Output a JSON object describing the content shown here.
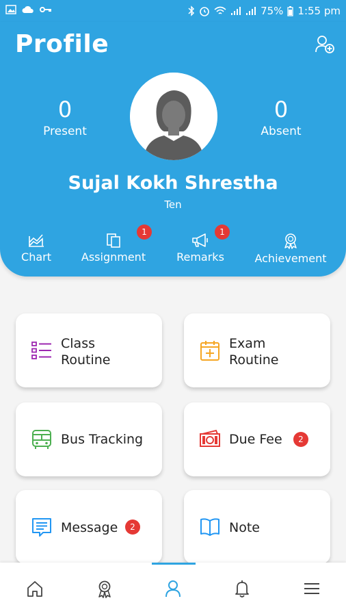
{
  "status_bar": {
    "battery": "75%",
    "time": "1:55 pm"
  },
  "header": {
    "title": "Profile",
    "present_count": "0",
    "present_label": "Present",
    "absent_count": "0",
    "absent_label": "Absent",
    "student_name": "Sujal Kokh Shrestha",
    "student_class": "Ten"
  },
  "quick_actions": [
    {
      "label": "Chart",
      "icon": "chart-icon"
    },
    {
      "label": "Assignment",
      "icon": "assignment-icon",
      "badge": "1"
    },
    {
      "label": "Remarks",
      "icon": "megaphone-icon",
      "badge": "1"
    },
    {
      "label": "Achievement",
      "icon": "award-icon"
    }
  ],
  "menu": {
    "class_routine": {
      "line1": "Class",
      "line2": "Routine"
    },
    "exam_routine": {
      "line1": "Exam",
      "line2": "Routine"
    },
    "bus_tracking": {
      "label": "Bus Tracking"
    },
    "due_fee": {
      "label": "Due Fee",
      "badge": "2"
    },
    "message": {
      "label": "Message",
      "badge": "2"
    },
    "note": {
      "label": "Note"
    }
  },
  "colors": {
    "primary": "#2fa4e1",
    "badge": "#e53935",
    "routine_purple": "#9c27b0",
    "exam_orange": "#f5a623",
    "bus_green": "#4caf50",
    "fee_red": "#e53935",
    "message_blue": "#2196f3"
  },
  "bottom_nav": [
    {
      "icon": "home-icon"
    },
    {
      "icon": "award-icon"
    },
    {
      "icon": "person-icon",
      "active": true
    },
    {
      "icon": "bell-icon"
    },
    {
      "icon": "menu-icon"
    }
  ]
}
